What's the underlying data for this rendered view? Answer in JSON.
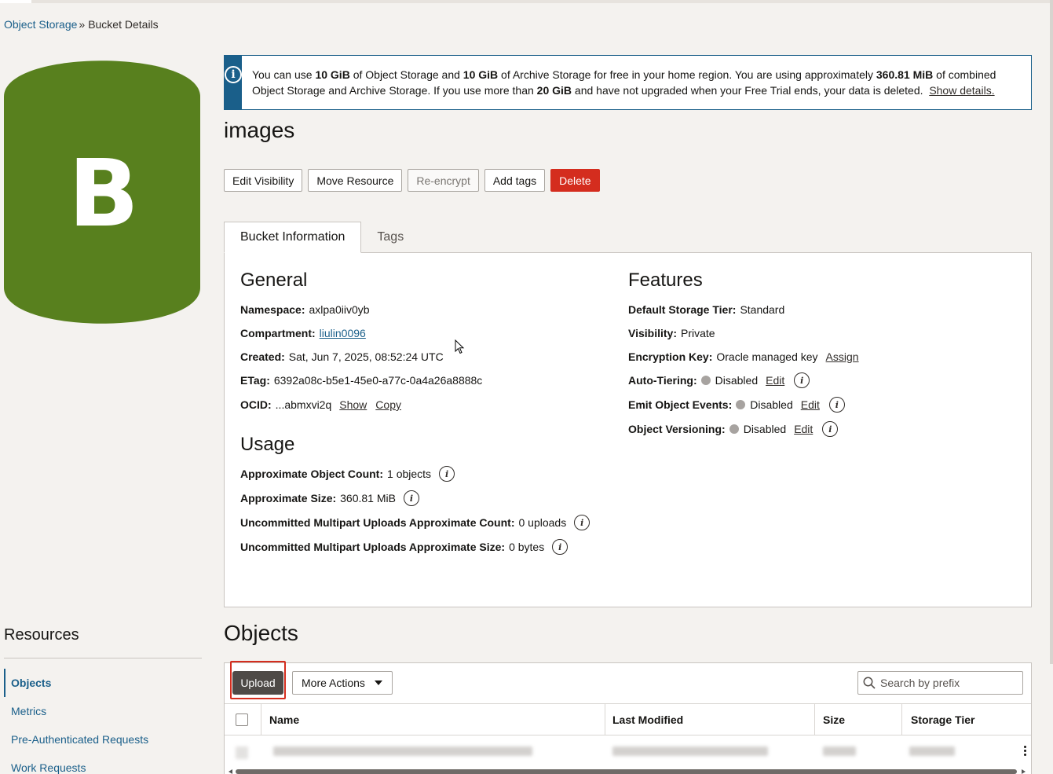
{
  "breadcrumb": {
    "root": "Object Storage",
    "separator": "»",
    "current": "Bucket Details"
  },
  "bucket_icon": {
    "letter": "B",
    "color": "#58801e"
  },
  "banner": {
    "icon": "info-icon",
    "p1": "You can use ",
    "b1": "10 GiB",
    "p2": " of Object Storage and ",
    "b2": "10 GiB",
    "p3": " of Archive Storage for free in your home region. You are using approximately ",
    "b3": "360.81 MiB",
    "p4": " of combined Object Storage and Archive Storage. If you use more than ",
    "b4": "20 GiB",
    "p5": " and have not upgraded when your Free Trial ends, your data is deleted.",
    "link": "Show details."
  },
  "title": "images",
  "actions": {
    "edit_visibility": "Edit Visibility",
    "move_resource": "Move Resource",
    "reencrypt": "Re-encrypt",
    "add_tags": "Add tags",
    "delete": "Delete"
  },
  "tabs": {
    "bucket_info": "Bucket Information",
    "tags": "Tags"
  },
  "general": {
    "heading": "General",
    "namespace_label": "Namespace:",
    "namespace": "axlpa0iiv0yb",
    "compartment_label": "Compartment:",
    "compartment": "liulin0096",
    "created_label": "Created:",
    "created": "Sat, Jun 7, 2025, 08:52:24 UTC",
    "etag_label": "ETag:",
    "etag": "6392a08c-b5e1-45e0-a77c-0a4a26a8888c",
    "ocid_label": "OCID:",
    "ocid": "...abmxvi2q",
    "show": "Show",
    "copy": "Copy"
  },
  "usage": {
    "heading": "Usage",
    "count_label": "Approximate Object Count:",
    "count": "1 objects",
    "size_label": "Approximate Size:",
    "size": "360.81 MiB",
    "mp_count_label": "Uncommitted Multipart Uploads Approximate Count:",
    "mp_count": "0 uploads",
    "mp_size_label": "Uncommitted Multipart Uploads Approximate Size:",
    "mp_size": "0 bytes"
  },
  "features": {
    "heading": "Features",
    "tier_label": "Default Storage Tier:",
    "tier": "Standard",
    "visibility_label": "Visibility:",
    "visibility": "Private",
    "enc_label": "Encryption Key:",
    "enc": "Oracle managed key",
    "assign": "Assign",
    "autotier_label": "Auto-Tiering:",
    "autotier": "Disabled",
    "events_label": "Emit Object Events:",
    "events": "Disabled",
    "versioning_label": "Object Versioning:",
    "versioning": "Disabled",
    "edit": "Edit"
  },
  "resources": {
    "title": "Resources",
    "items": [
      "Objects",
      "Metrics",
      "Pre-Authenticated Requests",
      "Work Requests"
    ]
  },
  "objects": {
    "title": "Objects",
    "upload": "Upload",
    "more_actions": "More Actions",
    "search_placeholder": "Search by prefix",
    "columns": [
      "Name",
      "Last Modified",
      "Size",
      "Storage Tier"
    ]
  }
}
